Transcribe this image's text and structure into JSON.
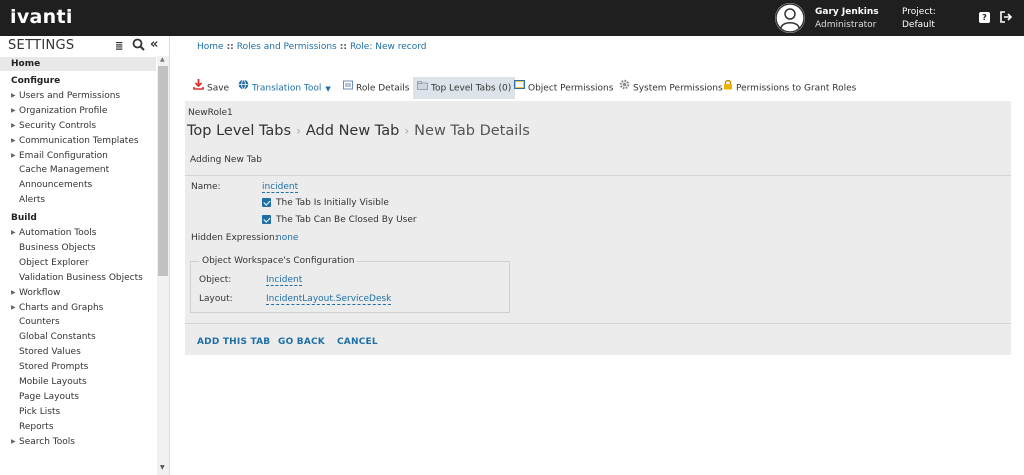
{
  "app": {
    "logo": "ivanti"
  },
  "user": {
    "name": "Gary Jenkins",
    "role": "Administrator"
  },
  "project": {
    "label": "Project:",
    "value": "Default"
  },
  "sidebar": {
    "title": "SETTINGS",
    "tree_icon_glyph": "≣",
    "collapse_glyph": "«",
    "home": "Home",
    "sections": [
      {
        "title": "Configure",
        "items": [
          {
            "label": "Users and Permissions",
            "caret": true
          },
          {
            "label": "Organization Profile",
            "caret": true
          },
          {
            "label": "Security Controls",
            "caret": true
          },
          {
            "label": "Communication Templates",
            "caret": true
          },
          {
            "label": "Email Configuration",
            "caret": true
          },
          {
            "label": "Cache Management",
            "caret": false
          },
          {
            "label": "Announcements",
            "caret": false
          },
          {
            "label": "Alerts",
            "caret": false
          }
        ]
      },
      {
        "title": "Build",
        "items": [
          {
            "label": "Automation Tools",
            "caret": true
          },
          {
            "label": "Business Objects",
            "caret": false
          },
          {
            "label": "Object Explorer",
            "caret": false
          },
          {
            "label": "Validation Business Objects",
            "caret": false
          },
          {
            "label": "Workflow",
            "caret": true
          },
          {
            "label": "Charts and Graphs",
            "caret": true
          },
          {
            "label": "Counters",
            "caret": false
          },
          {
            "label": "Global Constants",
            "caret": false
          },
          {
            "label": "Stored Values",
            "caret": false
          },
          {
            "label": "Stored Prompts",
            "caret": false
          },
          {
            "label": "Mobile Layouts",
            "caret": false
          },
          {
            "label": "Page Layouts",
            "caret": false
          },
          {
            "label": "Pick Lists",
            "caret": false
          },
          {
            "label": "Reports",
            "caret": false
          },
          {
            "label": "Search Tools",
            "caret": true
          }
        ]
      }
    ]
  },
  "breadcrumb": {
    "items": [
      "Home",
      "Roles and Permissions",
      "Role: New record"
    ],
    "separator": "::"
  },
  "toolbar": {
    "save": "Save",
    "translation": "Translation Tool",
    "role_details": "Role Details",
    "top_level_tabs": "Top Level Tabs (0)",
    "object_permissions": "Object Permissions",
    "system_permissions": "System Permissions",
    "grant_roles": "Permissions to Grant Roles"
  },
  "form": {
    "role_name": "NewRole1",
    "heading": [
      "Top Level Tabs",
      "Add New Tab",
      "New Tab Details"
    ],
    "heading_sep": "›",
    "subtitle": "Adding New Tab",
    "name_label": "Name:",
    "name_value": "incident",
    "checkbox_visible": "The Tab Is Initially Visible",
    "checkbox_closable": "The Tab Can Be Closed By User",
    "hidden_label": "Hidden Expression:",
    "hidden_value": "none",
    "workspace": {
      "legend": "Object Workspace's Configuration",
      "object_label": "Object:",
      "object_value": "Incident",
      "layout_label": "Layout:",
      "layout_value": "IncidentLayout.ServiceDesk"
    }
  },
  "actions": {
    "add": "ADD THIS TAB",
    "back": "GO BACK",
    "cancel": "CANCEL"
  },
  "colors": {
    "accent": "#1f6fa6",
    "topbar": "#1f1f1f",
    "panel": "#ececec",
    "save_red": "#d9322b",
    "lock_yellow": "#e8b400"
  }
}
